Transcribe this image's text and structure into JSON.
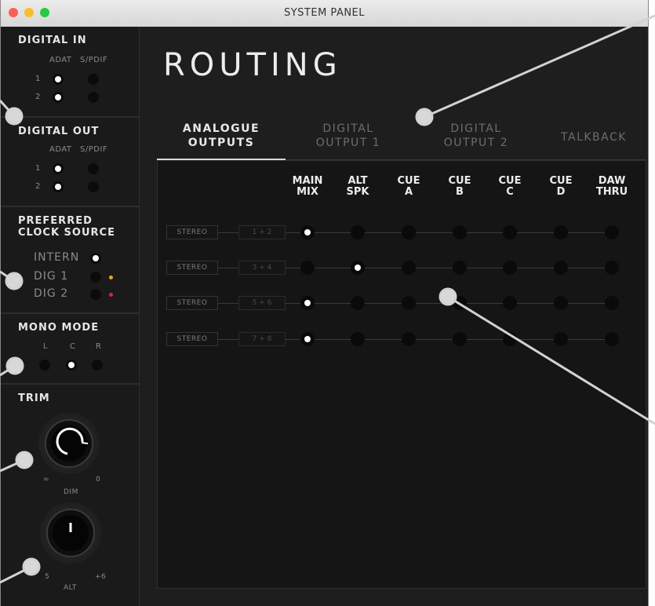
{
  "window": {
    "title": "SYSTEM PANEL",
    "traffic_lights": [
      "#fc5f57",
      "#fdbc2e",
      "#28c840"
    ]
  },
  "sidebar": {
    "digital_in": {
      "title": "DIGITAL IN",
      "col_labels": [
        "ADAT",
        "S/PDIF"
      ],
      "rows": [
        {
          "label": "1",
          "adat": true,
          "spdif": false
        },
        {
          "label": "2",
          "adat": true,
          "spdif": false
        }
      ]
    },
    "digital_out": {
      "title": "DIGITAL OUT",
      "col_labels": [
        "ADAT",
        "S/PDIF"
      ],
      "rows": [
        {
          "label": "1",
          "adat": true,
          "spdif": false
        },
        {
          "label": "2",
          "adat": true,
          "spdif": false
        }
      ]
    },
    "clock": {
      "title_line1": "PREFERRED",
      "title_line2": "CLOCK SOURCE",
      "options": [
        {
          "label": "INTERN",
          "selected": true,
          "led": ""
        },
        {
          "label": "DIG 1",
          "selected": false,
          "led": "#f0a020"
        },
        {
          "label": "DIG 2",
          "selected": false,
          "led": "#e0204a"
        }
      ]
    },
    "mono": {
      "title": "MONO MODE",
      "options": [
        {
          "label": "L",
          "selected": false
        },
        {
          "label": "C",
          "selected": true
        },
        {
          "label": "R",
          "selected": false
        }
      ]
    },
    "trim": {
      "title": "TRIM",
      "dim_knob": {
        "label": "DIM",
        "min_label": "∞",
        "max_label": "0"
      },
      "alt_knob": {
        "label": "ALT",
        "min_label": "5",
        "max_label": "+6"
      }
    }
  },
  "main": {
    "heading": "ROUTING",
    "tabs": [
      {
        "line1": "ANALOGUE",
        "line2": "OUTPUTS",
        "active": true
      },
      {
        "line1": "DIGITAL",
        "line2": "OUTPUT 1",
        "active": false
      },
      {
        "line1": "DIGITAL",
        "line2": "OUTPUT 2",
        "active": false
      },
      {
        "line1": "TALKBACK",
        "line2": "",
        "active": false
      }
    ],
    "columns": [
      {
        "line1": "MAIN",
        "line2": "MIX"
      },
      {
        "line1": "ALT",
        "line2": "SPK"
      },
      {
        "line1": "CUE",
        "line2": "A"
      },
      {
        "line1": "CUE",
        "line2": "B"
      },
      {
        "line1": "CUE",
        "line2": "C"
      },
      {
        "line1": "CUE",
        "line2": "D"
      },
      {
        "line1": "DAW",
        "line2": "THRU"
      }
    ],
    "rows": [
      {
        "mode": "STEREO",
        "pair": "1 + 2",
        "selected_column": 0
      },
      {
        "mode": "STEREO",
        "pair": "3 + 4",
        "selected_column": 1
      },
      {
        "mode": "STEREO",
        "pair": "5 + 6",
        "selected_column": 0
      },
      {
        "mode": "STEREO",
        "pair": "7 + 8",
        "selected_column": 0
      }
    ]
  }
}
